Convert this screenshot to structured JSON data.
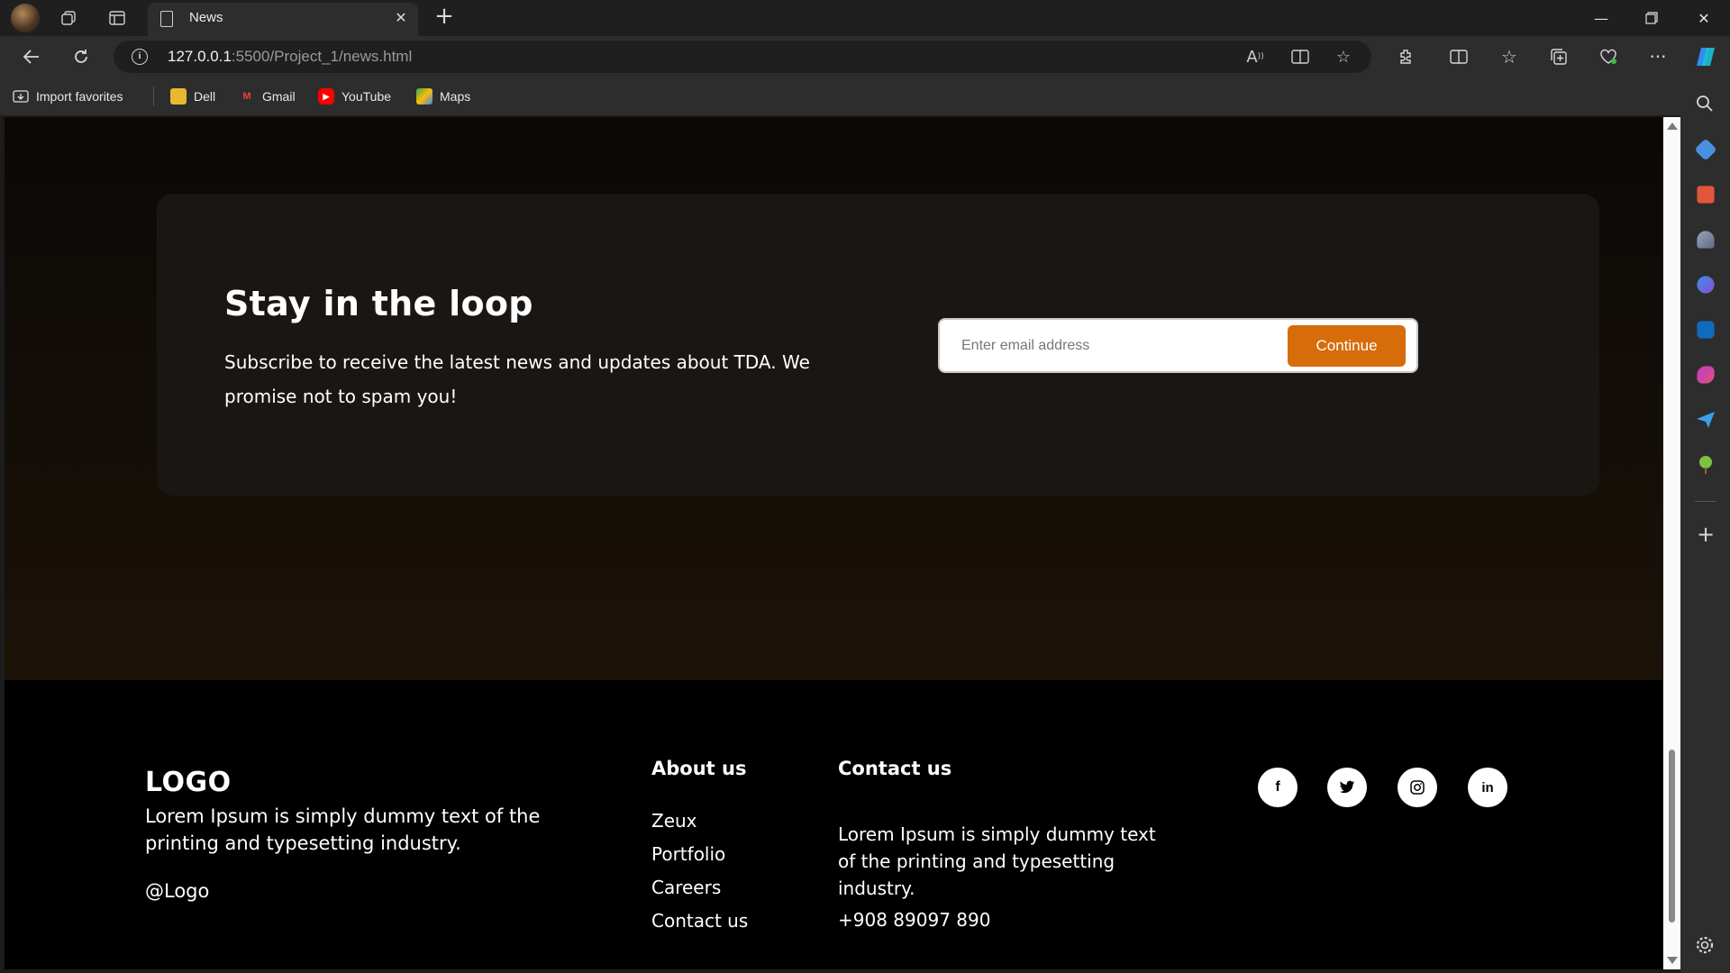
{
  "browser": {
    "tab_title": "News",
    "url_host": "127.0.0.1",
    "url_path": ":5500/Project_1/news.html",
    "favorites": [
      "Import favorites",
      "Dell",
      "Gmail",
      "YouTube",
      "Maps"
    ]
  },
  "newsletter": {
    "heading": "Stay in the loop",
    "description": "Subscribe to receive the latest news and updates about TDA. We promise not to spam you!",
    "email_placeholder": "Enter email address",
    "button_label": "Continue",
    "accent": "#d66c0a"
  },
  "footer": {
    "logo": "LOGO",
    "description": "Lorem Ipsum is simply dummy text of the printing and typesetting industry.",
    "handle": "@Logo",
    "about": {
      "title": "About us",
      "links": [
        "Zeux",
        "Portfolio",
        "Careers",
        "Contact us"
      ]
    },
    "contact": {
      "title": "Contact us",
      "description": "Lorem Ipsum is simply dummy text of the printing and typesetting industry.",
      "phone": "+908 89097 890"
    },
    "social": [
      "facebook-icon",
      "twitter-icon",
      "instagram-icon",
      "linkedin-icon"
    ]
  }
}
